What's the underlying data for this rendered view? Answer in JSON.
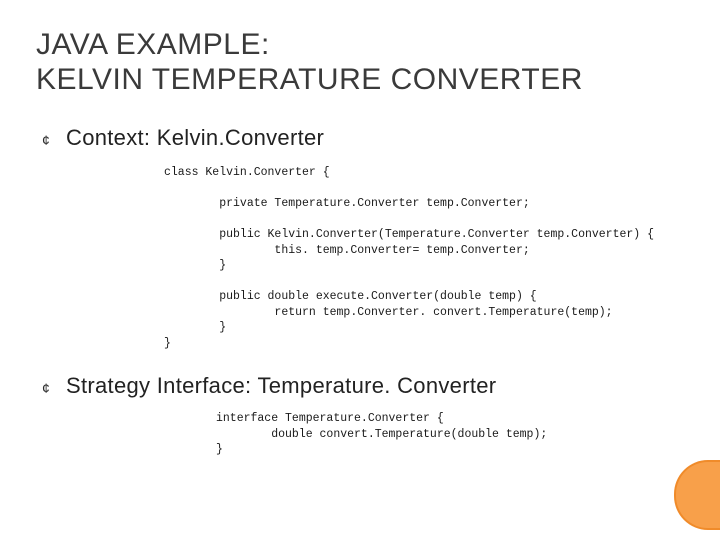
{
  "title": {
    "line1": "JAVA EXAMPLE:",
    "line2": "KELVIN TEMPERATURE CONVERTER"
  },
  "bullets": [
    {
      "glyph": "¢",
      "text": "Context: Kelvin.Converter"
    },
    {
      "glyph": "¢",
      "text": "Strategy Interface: Temperature. Converter"
    }
  ],
  "code1": "class Kelvin.Converter {\n\n        private Temperature.Converter temp.Converter;\n\n        public Kelvin.Converter(Temperature.Converter temp.Converter) {\n                this. temp.Converter= temp.Converter;\n        }\n\n        public double execute.Converter(double temp) {\n                return temp.Converter. convert.Temperature(temp);\n        }\n}",
  "code2": "interface Temperature.Converter {\n        double convert.Temperature(double temp);\n}"
}
